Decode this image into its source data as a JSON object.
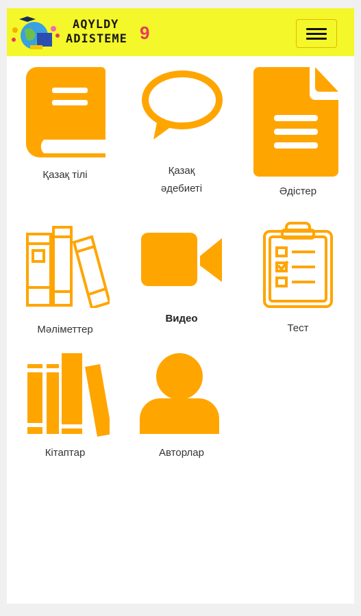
{
  "header": {
    "logo_line1": "AQYLDY",
    "logo_line2": "ADISTEME",
    "logo_number": "9",
    "menu_icon": "hamburger-menu-icon"
  },
  "accent_color": "#ffa500",
  "header_color": "#f4f72a",
  "tiles": [
    {
      "label": "Қазақ тілі",
      "icon": "book-icon"
    },
    {
      "label": "Қазақ",
      "label2": "әдебиеті",
      "icon": "speech-bubble-icon"
    },
    {
      "label": "Әдістер",
      "icon": "document-icon"
    },
    {
      "label": "Мәліметтер",
      "icon": "books-icon"
    },
    {
      "label": "Видео",
      "icon": "video-camera-icon"
    },
    {
      "label": "Тест",
      "icon": "clipboard-checklist-icon"
    },
    {
      "label": "Кітаптар",
      "icon": "library-books-icon"
    },
    {
      "label": "Авторлар",
      "icon": "user-icon"
    }
  ]
}
